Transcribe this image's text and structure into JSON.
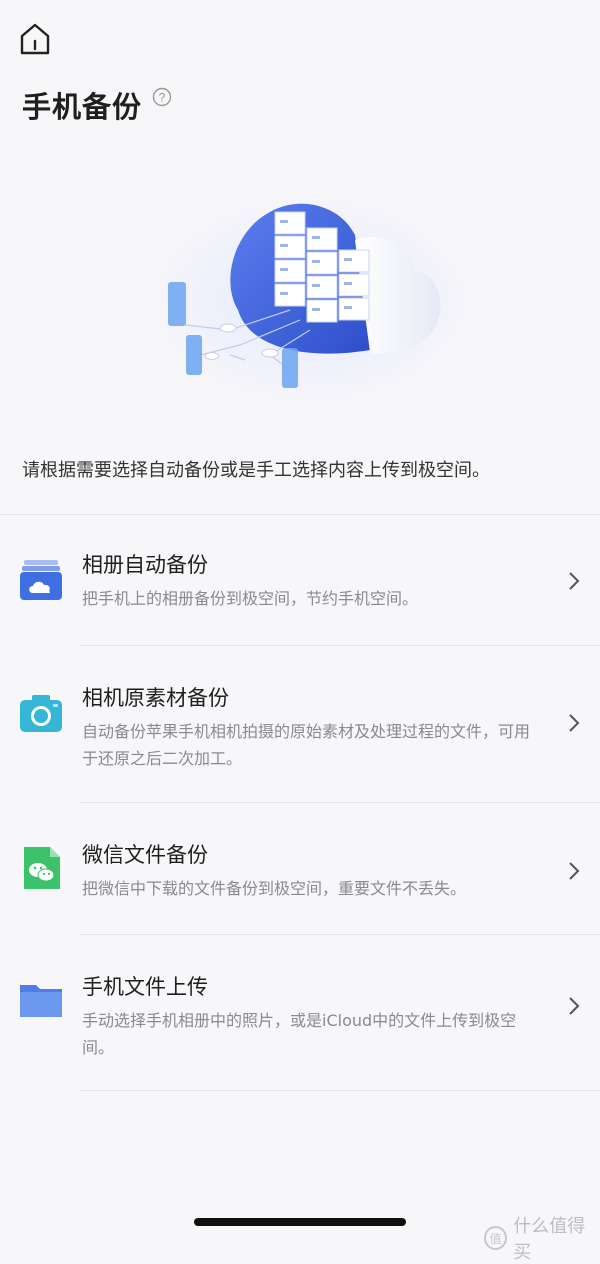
{
  "header": {
    "home_icon": "home-icon",
    "title": "手机备份",
    "help_icon": "question-circle-icon"
  },
  "hero": {
    "illustration": "cloud-server-illustration"
  },
  "intro": "请根据需要选择自动备份或是手工选择内容上传到极空间。",
  "items": [
    {
      "title": "相册自动备份",
      "desc": "把手机上的相册备份到极空间，节约手机空间。",
      "icon": "photo-cloud-icon"
    },
    {
      "title": "相机原素材备份",
      "desc": "自动备份苹果手机相机拍摄的原始素材及处理过程的文件，可用于还原之后二次加工。",
      "icon": "camera-icon"
    },
    {
      "title": "微信文件备份",
      "desc": "把微信中下载的文件备份到极空间，重要文件不丢失。",
      "icon": "wechat-icon"
    },
    {
      "title": "手机文件上传",
      "desc": "手动选择手机相册中的照片，或是iCloud中的文件上传到极空间。",
      "icon": "folder-icon"
    }
  ],
  "watermark": {
    "badge": "值",
    "text": "什么值得买"
  },
  "colors": {
    "accent_blue": "#3f6fe0",
    "teal": "#35b6d6",
    "green": "#3bc26a"
  }
}
